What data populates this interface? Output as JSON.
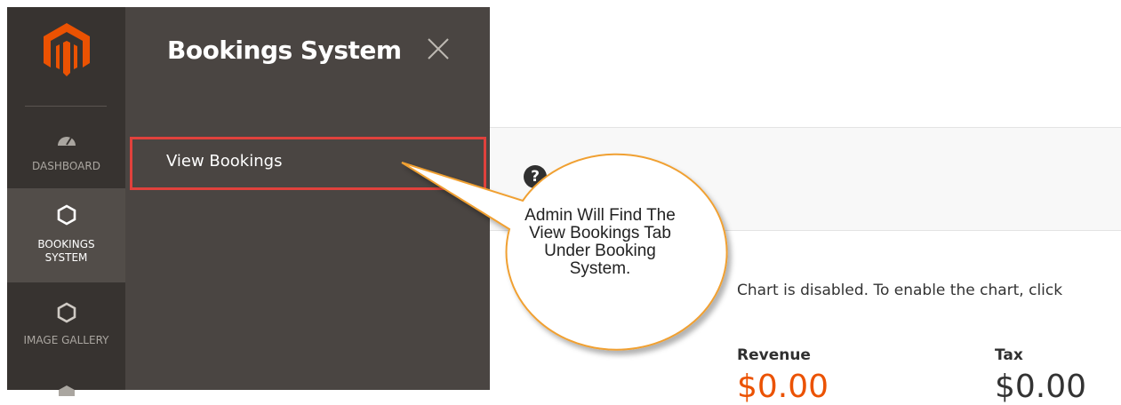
{
  "sidebar": {
    "logo_icon": "magento-logo-icon",
    "items": [
      {
        "label": "DASHBOARD",
        "icon": "dashboard-gauge-icon"
      },
      {
        "label_line1": "BOOKINGS",
        "label_line2": "SYSTEM",
        "icon": "hexagon-icon"
      },
      {
        "label": "IMAGE GALLERY",
        "icon": "hexagon-icon"
      }
    ]
  },
  "flyout": {
    "title": "Bookings System",
    "close_icon": "close-icon",
    "items": [
      {
        "label": "View Bookings"
      }
    ]
  },
  "main": {
    "help_icon_glyph": "?",
    "chart_message": "Chart is disabled. To enable the chart, click",
    "stats": [
      {
        "label": "Revenue",
        "value": "$0.00",
        "color": "#eb5202"
      },
      {
        "label": "Tax",
        "value": "$0.00",
        "color": "#333333"
      }
    ]
  },
  "callout": {
    "text": "Admin Will Find The View Bookings Tab Under Booking System.",
    "fill": "#ffffff",
    "border": "#f0a030"
  },
  "colors": {
    "sidebar_bg": "#373330",
    "flyout_bg": "#4a4542",
    "highlight_border": "#e0413c",
    "brand_orange": "#eb5202"
  }
}
